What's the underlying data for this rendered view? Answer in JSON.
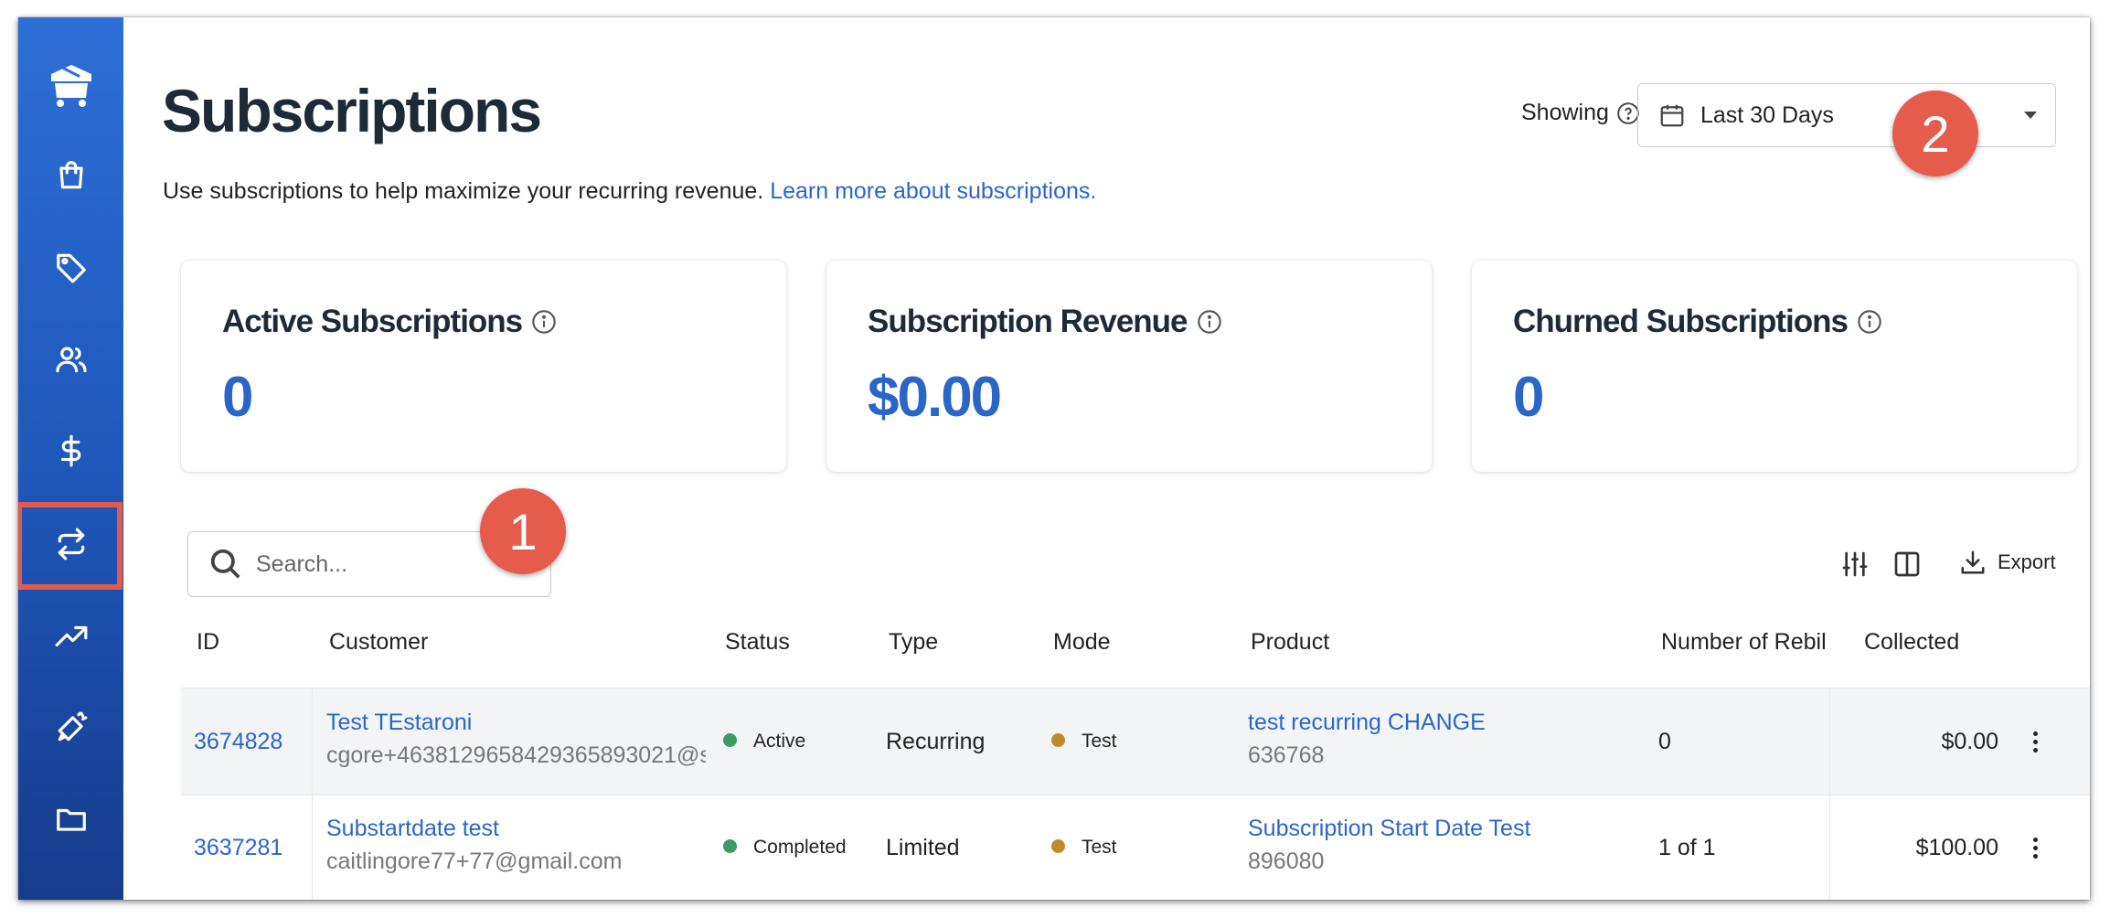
{
  "sidebar": {
    "items": [
      {
        "icon": "logo-icon"
      },
      {
        "icon": "shopping-bag-icon"
      },
      {
        "icon": "tag-icon"
      },
      {
        "icon": "users-icon"
      },
      {
        "icon": "dollar-icon"
      },
      {
        "icon": "repeat-icon",
        "active": true
      },
      {
        "icon": "trending-up-icon"
      },
      {
        "icon": "megaphone-icon"
      },
      {
        "icon": "folder-icon"
      }
    ],
    "active_highlight_color": "#e05a4f",
    "background": "#1f55b8"
  },
  "header": {
    "title": "Subscriptions",
    "subtitle": "Use subscriptions to help maximize your recurring revenue.",
    "learn_more_link": "Learn more about subscriptions.",
    "showing_label": "Showing",
    "date_range": "Last 30 Days"
  },
  "annotations": {
    "badge_1": "1",
    "badge_2": "2",
    "badge_color": "#e65c4c"
  },
  "stats": [
    {
      "label": "Active Subscriptions",
      "value": "0"
    },
    {
      "label": "Subscription Revenue",
      "value": "$0.00"
    },
    {
      "label": "Churned Subscriptions",
      "value": "0"
    }
  ],
  "search": {
    "placeholder": "Search..."
  },
  "toolbar": {
    "export_label": "Export"
  },
  "table": {
    "columns": [
      "ID",
      "Customer",
      "Status",
      "Type",
      "Mode",
      "Product",
      "Number of Rebil",
      "Collected"
    ],
    "rows": [
      {
        "id": "3674828",
        "customer_name": "Test TEstaroni",
        "customer_email": "cgore+463812965842936589302​1@s",
        "status": "Active",
        "status_color": "#3a9b63",
        "type": "Recurring",
        "mode": "Test",
        "mode_color": "#c1892d",
        "product_name": "test recurring CHANGE",
        "product_id": "636768",
        "rebills": "0",
        "collected": "$0.00"
      },
      {
        "id": "3637281",
        "customer_name": "Substartdate test",
        "customer_email": "caitlingore77+77@gmail.com",
        "status": "Completed",
        "status_color": "#3a9b63",
        "type": "Limited",
        "mode": "Test",
        "mode_color": "#c1892d",
        "product_name": "Subscription Start Date Test",
        "product_id": "896080",
        "rebills": "1 of 1",
        "collected": "$100.00"
      }
    ]
  }
}
